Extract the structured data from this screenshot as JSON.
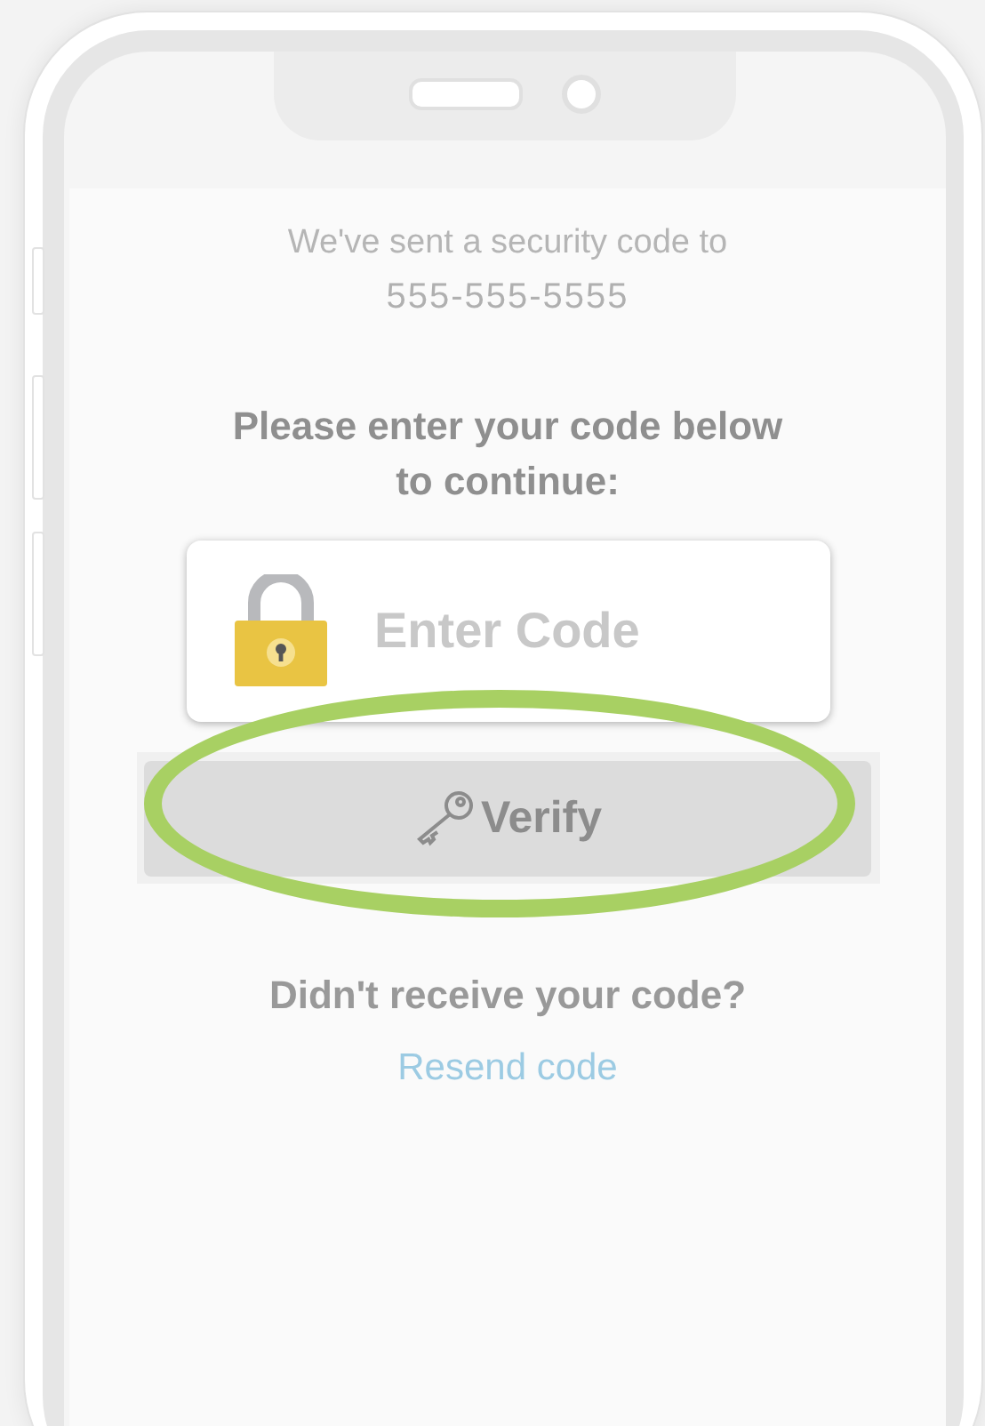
{
  "message": {
    "line_1": "We've sent a security code to",
    "phone": "555-555-5555"
  },
  "prompt": [
    "Please enter your code below",
    "to continue:"
  ],
  "code_field": {
    "placeholder": "Enter Code"
  },
  "verify_button": {
    "label": "Verify",
    "disabled": true,
    "highlighted": true
  },
  "resend": {
    "question": "Didn't receive your code?",
    "link": "Resend code"
  }
}
